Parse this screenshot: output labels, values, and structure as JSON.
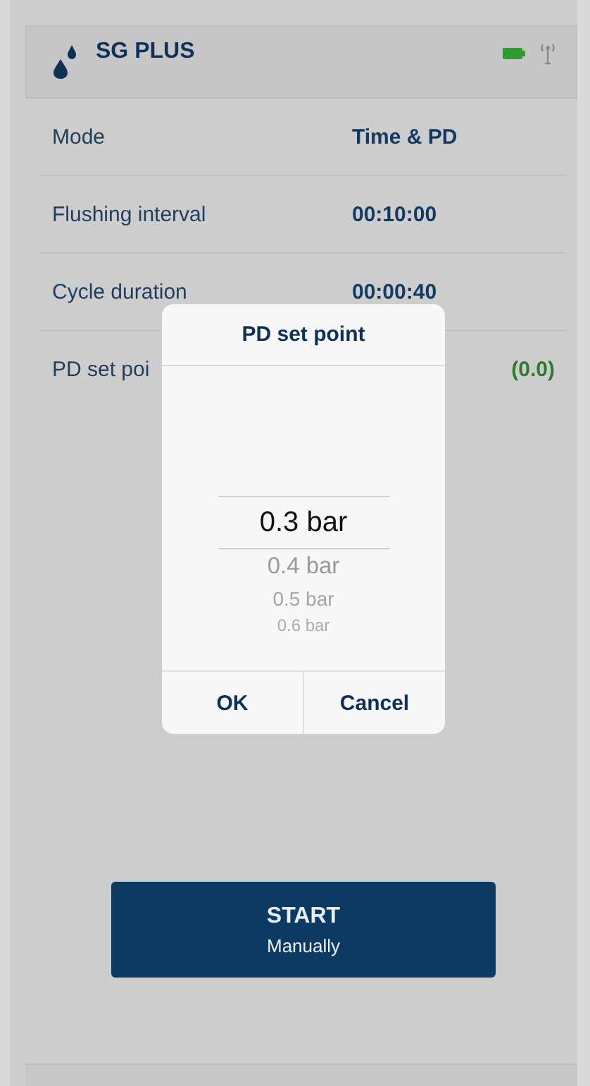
{
  "header": {
    "title": "SG PLUS"
  },
  "rows": [
    {
      "label": "Mode",
      "value": "Time & PD",
      "color": "#123a63"
    },
    {
      "label": "Flushing interval",
      "value": "00:10:00",
      "color": "#123a63"
    },
    {
      "label": "Cycle duration",
      "value": "00:00:40",
      "color": "#123a63"
    },
    {
      "label": "PD set poi",
      "value": "(0.0)",
      "color": "#2e7a2e",
      "kind": "reading"
    }
  ],
  "start_button": {
    "label": "START",
    "sublabel": "Manually"
  },
  "dialog": {
    "title": "PD set point",
    "options": [
      {
        "label": "0.3 bar",
        "selected": true
      },
      {
        "label": "0.4 bar",
        "selected": false
      },
      {
        "label": "0.5 bar",
        "selected": false
      },
      {
        "label": "0.6 bar",
        "selected": false
      }
    ],
    "buttons": [
      "OK",
      "Cancel"
    ]
  }
}
